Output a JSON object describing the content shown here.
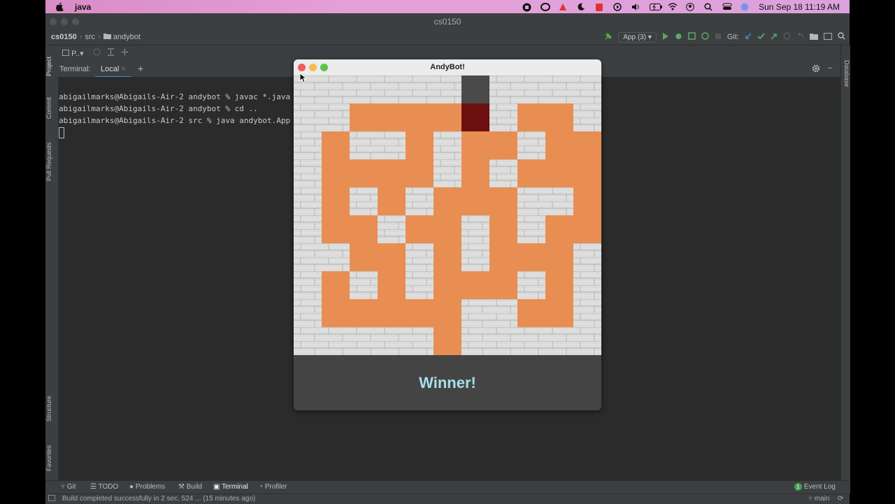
{
  "menubar": {
    "app_name": "java",
    "clock": "Sun Sep 18  11:19 AM"
  },
  "ide": {
    "window_title": "cs0150",
    "breadcrumb": [
      "cs0150",
      "src",
      "andybot"
    ],
    "run_config": "App (3)",
    "git_label": "Git:",
    "project_tab": "P..",
    "left_tabs": [
      "Project",
      "Commit",
      "Pull Requests",
      "Structure",
      "Favorites"
    ],
    "right_tabs": [
      "Database"
    ],
    "terminal": {
      "label": "Terminal:",
      "tab": "Local",
      "lines": [
        "abigailmarks@Abigails-Air-2 andybot % javac *.java",
        "abigailmarks@Abigails-Air-2 andybot % cd ..",
        "abigailmarks@Abigails-Air-2 src % java andybot.App"
      ]
    },
    "bottom_tabs": [
      "Git",
      "TODO",
      "Problems",
      "Build",
      "Terminal",
      "Profiler"
    ],
    "active_bottom_tab": "Terminal",
    "event_log": "Event Log",
    "event_log_count": "1",
    "status_message": "Build completed successfully in 2 sec, 524 ... (15 minutes ago)",
    "branch": "main"
  },
  "game": {
    "title": "AndyBot!",
    "message": "Winner!",
    "colors": {
      "path": "#e88e52",
      "wall": "#dcdcdc",
      "start": "#4a4a4a",
      "robot": "#6b0f10",
      "panel": "#444444",
      "message": "#a9dfea"
    },
    "grid": [
      "WWWWWWSWWWW",
      "WWPPPPRWPPW",
      "WPWWPWPPWPP",
      "WPPPPWPWPPP",
      "WPWPWPPPWWP",
      "WPPWPPWPWPP",
      "WWPPWPWPPPW",
      "WPWPWPPPWPW",
      "WPPPPPWWPPW",
      "WWWWWPWWWWW"
    ]
  }
}
